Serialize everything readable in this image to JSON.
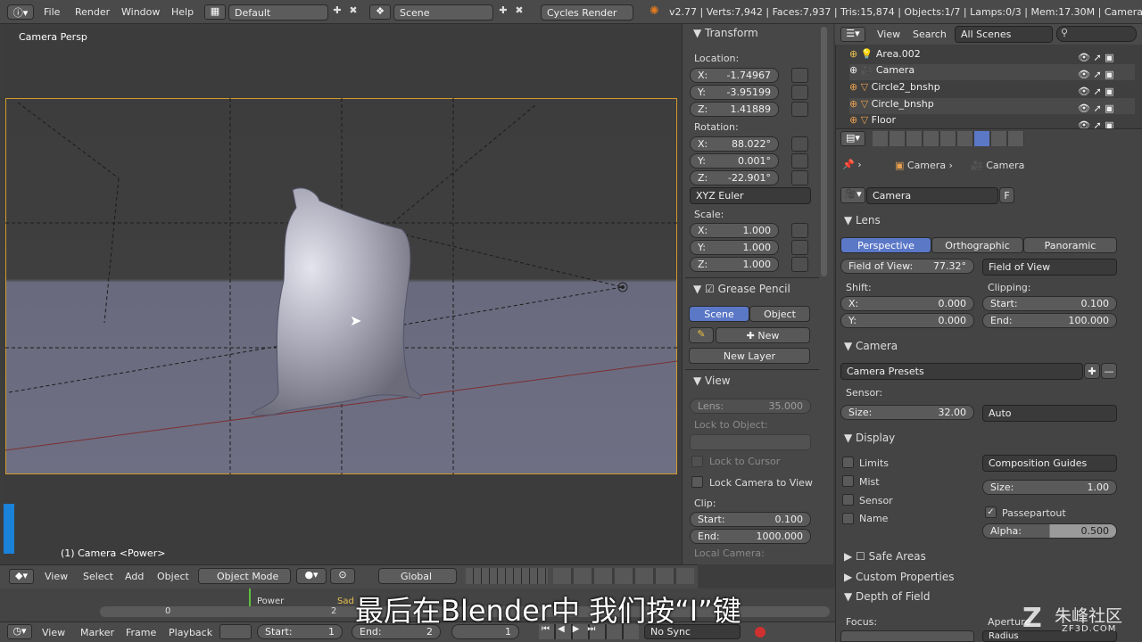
{
  "topbar": {
    "menus": [
      "File",
      "Render",
      "Window",
      "Help"
    ],
    "screen": "Default",
    "scene": "Scene",
    "engine": "Cycles Render",
    "stats": "v2.77 | Verts:7,942 | Faces:7,937 | Tris:15,874 | Objects:1/7 | Lamps:0/3 | Mem:17.30M | Camera"
  },
  "viewport": {
    "label": "Camera Persp",
    "object_label": "(1) Camera <Power>"
  },
  "vp_header": {
    "menus": [
      "View",
      "Select",
      "Add",
      "Object"
    ],
    "mode": "Object Mode",
    "orientation": "Global"
  },
  "transform": {
    "title": "Transform",
    "location_label": "Location:",
    "loc": [
      {
        "axis": "X:",
        "val": "-1.74967"
      },
      {
        "axis": "Y:",
        "val": "-3.95199"
      },
      {
        "axis": "Z:",
        "val": "1.41889"
      }
    ],
    "rotation_label": "Rotation:",
    "rot": [
      {
        "axis": "X:",
        "val": "88.022°"
      },
      {
        "axis": "Y:",
        "val": "0.001°"
      },
      {
        "axis": "Z:",
        "val": "-22.901°"
      }
    ],
    "euler": "XYZ Euler",
    "scale_label": "Scale:",
    "scale": [
      {
        "axis": "X:",
        "val": "1.000"
      },
      {
        "axis": "Y:",
        "val": "1.000"
      },
      {
        "axis": "Z:",
        "val": "1.000"
      }
    ]
  },
  "grease": {
    "title": "Grease Pencil",
    "tab_scene": "Scene",
    "tab_object": "Object",
    "new": "New",
    "new_layer": "New Layer"
  },
  "view": {
    "title": "View",
    "lens_label": "Lens:",
    "lens_val": "35.000",
    "lock_obj": "Lock to Object:",
    "lock_cursor": "Lock to Cursor",
    "lock_cam": "Lock Camera to View",
    "clip": "Clip:",
    "clip_start_label": "Start:",
    "clip_start": "0.100",
    "clip_end_label": "End:",
    "clip_end": "1000.000",
    "local_cam": "Local Camera:"
  },
  "outliner": {
    "menus": [
      "View",
      "Search"
    ],
    "scenes": "All Scenes",
    "items": [
      "Area.002",
      "Camera",
      "Circle2_bnshp",
      "Circle_bnshp",
      "Floor"
    ]
  },
  "props": {
    "crumb1": "Camera",
    "crumb2": "Camera",
    "name": "Camera",
    "fake": "F",
    "lens": {
      "title": "Lens",
      "tabs": [
        "Perspective",
        "Orthographic",
        "Panoramic"
      ],
      "fov_label": "Field of View:",
      "fov_val": "77.32°",
      "fov_mode": "Field of View",
      "shift": "Shift:",
      "clipping": "Clipping:",
      "shift_x_label": "X:",
      "shift_x": "0.000",
      "shift_y_label": "Y:",
      "shift_y": "0.000",
      "clip_start_label": "Start:",
      "clip_start": "0.100",
      "clip_end_label": "End:",
      "clip_end": "100.000"
    },
    "camera": {
      "title": "Camera",
      "presets": "Camera Presets",
      "sensor": "Sensor:",
      "size_label": "Size:",
      "size_val": "32.00",
      "fit": "Auto"
    },
    "display": {
      "title": "Display",
      "limits": "Limits",
      "mist": "Mist",
      "sensor": "Sensor",
      "name": "Name",
      "guides": "Composition Guides",
      "size_label": "Size:",
      "size_val": "1.00",
      "passepartout": "Passepartout",
      "alpha_label": "Alpha:",
      "alpha_val": "0.500"
    },
    "safe_areas": "Safe Areas",
    "custom": "Custom Properties",
    "dof": "Depth of Field",
    "focus": "Focus:",
    "aperture": "Aperture",
    "radius": "Radius"
  },
  "timeline": {
    "marker_power": "Power",
    "marker_sad": "Sad",
    "frame_start": "0",
    "frame_mid": "2",
    "menus": [
      "View",
      "Marker",
      "Frame",
      "Playback"
    ],
    "start_label": "Start:",
    "start": "1",
    "end_label": "End:",
    "end": "2",
    "current": "1",
    "sync": "No Sync"
  },
  "subtitle": "最后在Blender中 我们按“I”键",
  "watermark": {
    "main": "朱峰社区",
    "sub": "ZF3D.COM"
  }
}
